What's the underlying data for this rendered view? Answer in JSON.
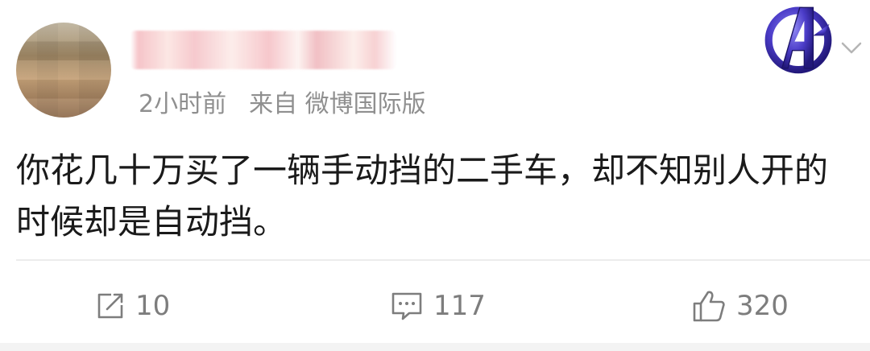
{
  "post": {
    "meta": {
      "time": "2小时前",
      "source": "来自 微博国际版"
    },
    "text": "你花几十万买了一辆手动挡的二手车，却不知别人开的时候却是自动挡。"
  },
  "actions": {
    "share_count": "10",
    "comment_count": "117",
    "like_count": "320"
  },
  "icons": {
    "badge": "avengers-logo-icon",
    "chevron": "chevron-down-icon",
    "share": "share-icon",
    "comment": "comment-icon",
    "like": "thumbs-up-icon"
  },
  "colors": {
    "meta_text": "#8f8f8f",
    "body_text": "#1a1a1a",
    "action_text": "#7d7d7d",
    "badge_purple": "#4b3cc8"
  }
}
